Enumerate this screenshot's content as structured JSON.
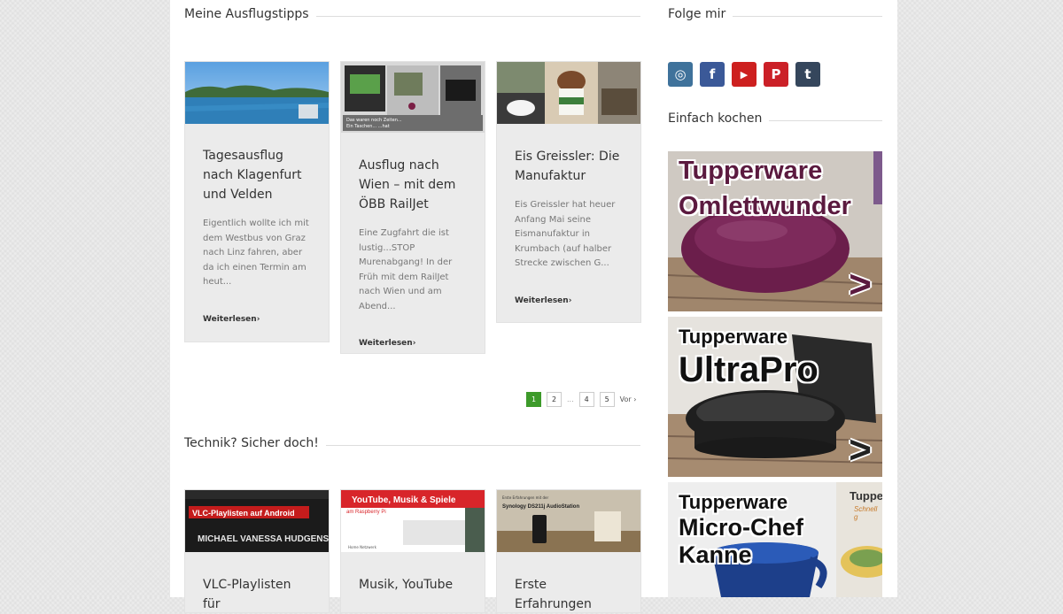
{
  "sections": {
    "ausflug_heading": "Meine Ausflugstipps",
    "technik_heading": "Technik? Sicher doch!",
    "follow_heading": "Folge mir",
    "kochen_heading": "Einfach kochen"
  },
  "ausflug_posts": [
    {
      "title": "Tagesausflug nach Klagenfurt und Velden",
      "excerpt": "Eigentlich wollte ich mit dem Westbus von Graz nach Linz fahren, aber da ich einen Termin am heut...",
      "more": "Weiterlesen"
    },
    {
      "title": "Ausflug nach Wien – mit dem ÖBB RailJet",
      "excerpt": "Eine Zugfahrt die ist lustig...STOP Murenabgang! In der Früh mit dem RailJet nach Wien und am Abend...",
      "more": "Weiterlesen",
      "thumb_caption_1": "Das waren noch Zeiten...",
      "thumb_caption_2": "Ein Taschen... ...hat"
    },
    {
      "title": "Eis Greissler: Die Manufaktur",
      "excerpt": "Eis Greissler hat heuer Anfang Mai seine Eismanufaktur in Krumbach (auf halber Strecke zwischen G...",
      "more": "Weiterlesen"
    }
  ],
  "pagination": {
    "pages": [
      "1",
      "2",
      "4",
      "5"
    ],
    "dots": "...",
    "next": "Vor"
  },
  "technik_posts": [
    {
      "title": "VLC-Playlisten für",
      "thumb_text": "VLC-Playlisten auf Android",
      "thumb_names": "MICHAEL VANESSA HUDGENS"
    },
    {
      "title": "Musik, YouTube",
      "thumb_text": "YouTube, Musik & Spiele",
      "thumb_sub": "am Raspberry Pi",
      "thumb_small": "Home Netzwerk"
    },
    {
      "title": "Erste Erfahrungen",
      "thumb_text": "Synology DS211j AudioStation",
      "thumb_small": "Erste Erfahrungen mit der"
    }
  ],
  "social": [
    {
      "icon": "instagram-icon",
      "glyph": "◎",
      "color": "#3f729b"
    },
    {
      "icon": "facebook-icon",
      "glyph": "f",
      "color": "#3b5998"
    },
    {
      "icon": "youtube-icon",
      "glyph": "▶",
      "color": "#cd201f"
    },
    {
      "icon": "pinterest-icon",
      "glyph": "P",
      "color": "#cb2027"
    },
    {
      "icon": "tumblr-icon",
      "glyph": "t",
      "color": "#35465c"
    }
  ],
  "ads": [
    {
      "line1": "Tupperware",
      "line2": "Omlettwunder",
      "arrow": ">"
    },
    {
      "line1": "Tupperware",
      "line2": "UltraPro",
      "arrow": ">"
    },
    {
      "line1": "Tupperware",
      "line2": "Micro-Chef Kanne",
      "corner": "Tuppe",
      "corner_sub": "Schnell g"
    }
  ]
}
